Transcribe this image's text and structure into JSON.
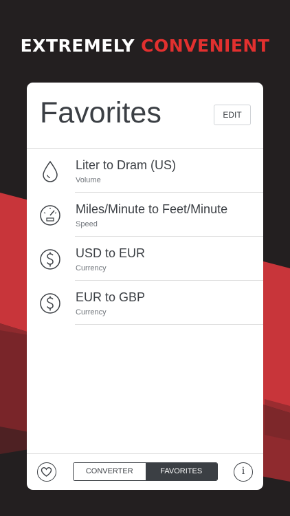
{
  "headline": {
    "part1": "EXTREMELY",
    "part2": "CONVENIENT"
  },
  "colors": {
    "accent": "#e2302f",
    "background": "#231f20",
    "text": "#3b3f44"
  },
  "screen": {
    "title": "Favorites",
    "edit_label": "EDIT",
    "favorites": [
      {
        "name": "Liter to Dram (US)",
        "category": "Volume",
        "icon": "drop-icon"
      },
      {
        "name": "Miles/Minute to Feet/Minute",
        "category": "Speed",
        "icon": "speedometer-icon"
      },
      {
        "name": "USD to EUR",
        "category": "Currency",
        "icon": "dollar-coin-icon"
      },
      {
        "name": "EUR to GBP",
        "category": "Currency",
        "icon": "dollar-coin-icon"
      }
    ]
  },
  "footer": {
    "converter_label": "CONVERTER",
    "favorites_label": "FAVORITES",
    "selected_tab": "FAVORITES",
    "info_glyph": "i"
  }
}
